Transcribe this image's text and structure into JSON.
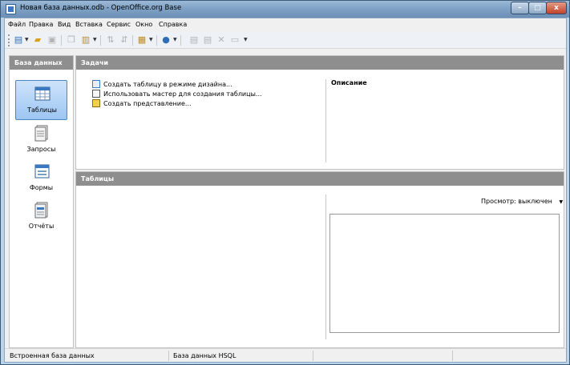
{
  "window": {
    "title": "Новая база данных.odb - OpenOffice.org Base",
    "controls": {
      "minimize": "–",
      "maximize": "□",
      "close": "x"
    }
  },
  "menu": [
    "Файл",
    "Правка",
    "Вид",
    "Вставка",
    "Сервис",
    "Окно",
    "Справка"
  ],
  "toolbar": {
    "icons": [
      "new-document",
      "open-folder",
      "save",
      "copy",
      "paste",
      "sort-ascending",
      "sort-descending",
      "form",
      "help",
      "table-view",
      "query-view",
      "delete",
      "rename"
    ]
  },
  "sidebar": {
    "header": "База данных",
    "items": [
      {
        "label": "Таблицы",
        "icon": "table-icon",
        "selected": true
      },
      {
        "label": "Запросы",
        "icon": "query-icon",
        "selected": false
      },
      {
        "label": "Формы",
        "icon": "form-icon",
        "selected": false
      },
      {
        "label": "Отчёты",
        "icon": "report-icon",
        "selected": false
      }
    ]
  },
  "tasks": {
    "header": "Задачи",
    "items": [
      "Создать таблицу в режиме дизайна...",
      "Использовать мастер для создания таблицы...",
      "Создать представление..."
    ],
    "description_title": "Описание"
  },
  "tables": {
    "header": "Таблицы",
    "preview_label": "Просмотр: выключен"
  },
  "status": {
    "left": "Встроенная база данных",
    "middle": "База данных HSQL"
  },
  "colors": {
    "panel_header": "#8e8e8e",
    "selected_item": "#9cc6f2",
    "titlebar": "#7fa2c6"
  }
}
